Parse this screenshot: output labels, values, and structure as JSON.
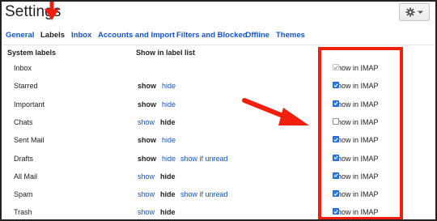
{
  "header": {
    "title": "Settings",
    "gear_icon": "gear-icon"
  },
  "tabs": [
    {
      "label": "General",
      "active": false
    },
    {
      "label": "Labels",
      "active": true
    },
    {
      "label": "Inbox",
      "active": false
    },
    {
      "label": "Accounts and Import",
      "active": false
    },
    {
      "label": "Filters and Blocked",
      "active": false
    },
    {
      "label": "Offline",
      "active": false
    },
    {
      "label": "Themes",
      "active": false
    }
  ],
  "columns": {
    "system_labels": "System labels",
    "show_in_label_list": "Show in label list"
  },
  "rows": [
    {
      "name": "Inbox",
      "show": "",
      "hide": "",
      "extra": "",
      "show_style": "none",
      "hide_style": "none",
      "imap": "Show in IMAP",
      "imap_state": "disabled"
    },
    {
      "name": "Starred",
      "show": "show",
      "hide": "hide",
      "extra": "",
      "show_style": "bold",
      "hide_style": "link",
      "imap": "Show in IMAP",
      "imap_state": "checked"
    },
    {
      "name": "Important",
      "show": "show",
      "hide": "hide",
      "extra": "",
      "show_style": "bold",
      "hide_style": "link",
      "imap": "Show in IMAP",
      "imap_state": "checked"
    },
    {
      "name": "Chats",
      "show": "show",
      "hide": "hide",
      "extra": "",
      "show_style": "link",
      "hide_style": "bold",
      "imap": "Show in IMAP",
      "imap_state": "unchecked"
    },
    {
      "name": "Sent Mail",
      "show": "show",
      "hide": "hide",
      "extra": "",
      "show_style": "bold",
      "hide_style": "link",
      "imap": "Show in IMAP",
      "imap_state": "checked"
    },
    {
      "name": "Drafts",
      "show": "show",
      "hide": "hide",
      "extra": "show if unread",
      "show_style": "bold",
      "hide_style": "link",
      "imap": "Show in IMAP",
      "imap_state": "checked"
    },
    {
      "name": "All Mail",
      "show": "show",
      "hide": "hide",
      "extra": "",
      "show_style": "link",
      "hide_style": "bold",
      "imap": "Show in IMAP",
      "imap_state": "checked"
    },
    {
      "name": "Spam",
      "show": "show",
      "hide": "hide",
      "extra": "show if unread",
      "show_style": "link",
      "hide_style": "bold",
      "imap": "Show in IMAP",
      "imap_state": "checked"
    },
    {
      "name": "Trash",
      "show": "show",
      "hide": "hide",
      "extra": "",
      "show_style": "link",
      "hide_style": "bold",
      "imap": "Show in IMAP",
      "imap_state": "checked"
    }
  ],
  "colors": {
    "link": "#1155cc",
    "annotation_red": "#f11f0e",
    "checkbox_blue": "#2c7ee6"
  }
}
